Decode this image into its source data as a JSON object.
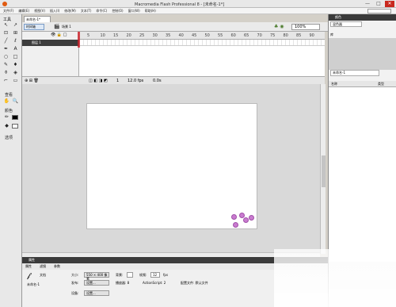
{
  "app": {
    "title": "Macromedia Flash Professional 8 - [未命名-1*]",
    "window_controls": [
      "—",
      "□",
      "✕"
    ]
  },
  "menubar": {
    "items": [
      "文件(F)",
      "编辑(E)",
      "视图(V)",
      "插入(I)",
      "修改(M)",
      "文本(T)",
      "命令(C)",
      "控制(O)",
      "窗口(W)",
      "帮助(H)"
    ]
  },
  "toolbox": {
    "header": "工具",
    "view_label": "查看",
    "colors_label": "颜色",
    "options_label": "选项"
  },
  "document": {
    "tab": "未命名-1*",
    "scene_button": "时间轴",
    "scene_name": "场景 1",
    "zoom": "100%"
  },
  "timeline": {
    "layer_name": "图层 1",
    "frame_numbers": [
      "5",
      "10",
      "15",
      "20",
      "25",
      "30",
      "35",
      "40",
      "45",
      "50",
      "55",
      "60",
      "65",
      "70",
      "75",
      "80",
      "85",
      "90"
    ],
    "status_frame": "1",
    "status_fps": "12.0 fps",
    "status_time": "0.0s"
  },
  "right_panel": {
    "title": "颜色",
    "tab": "混色器",
    "sub": "库",
    "dropdown": "未命名-1",
    "col_name": "名称",
    "col_type": "类型"
  },
  "properties": {
    "panel_title": "属性",
    "tabs": [
      "属性",
      "滤镜",
      "参数"
    ],
    "doc_label": "文档",
    "doc_name": "未命名-1",
    "size_label": "大小:",
    "size_value": "550 × 400 像素",
    "bg_label": "背景:",
    "fps_label": "帧频:",
    "fps_value": "12",
    "fps_unit": "fps",
    "publish_label": "发布:",
    "publish_btn": "设置...",
    "player_label": "播放器: 8",
    "actionscript_label": "ActionScript: 2",
    "profile_label": "配置文件: 默认文件",
    "device_label": "设备:",
    "device_btn": "设置..."
  }
}
